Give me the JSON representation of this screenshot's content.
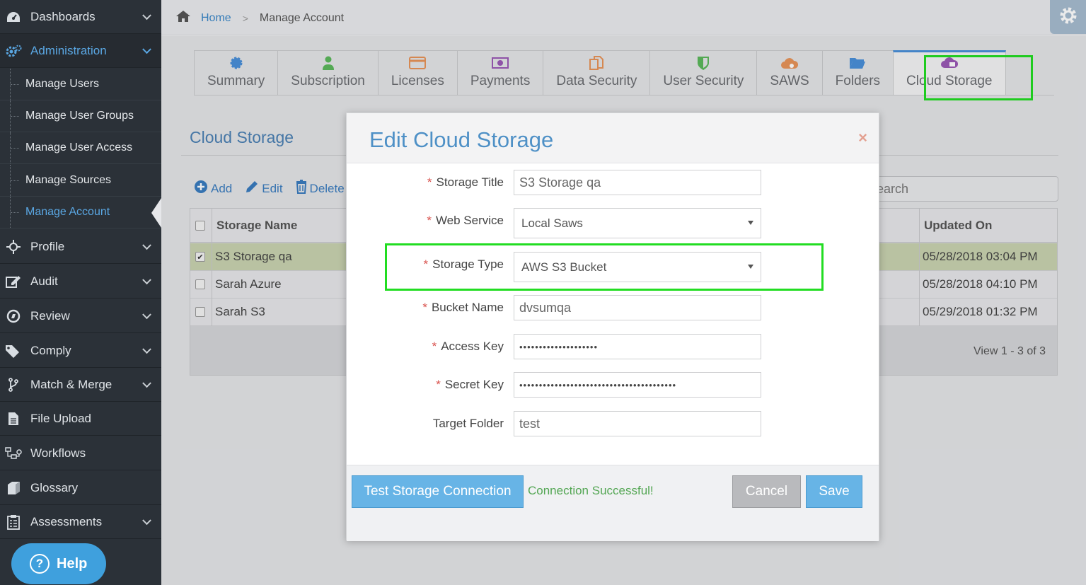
{
  "sidebar": {
    "items": [
      {
        "label": "Dashboards",
        "icon": "speedometer-icon"
      },
      {
        "label": "Administration",
        "icon": "gears-icon"
      },
      {
        "label": "Profile",
        "icon": "crosshair-icon"
      },
      {
        "label": "Audit",
        "icon": "edit-icon"
      },
      {
        "label": "Review",
        "icon": "compass-icon"
      },
      {
        "label": "Comply",
        "icon": "tags-icon"
      },
      {
        "label": "Match & Merge",
        "icon": "branch-icon"
      },
      {
        "label": "File Upload",
        "icon": "file-icon"
      },
      {
        "label": "Workflows",
        "icon": "workflow-icon"
      },
      {
        "label": "Glossary",
        "icon": "book-icon"
      },
      {
        "label": "Assessments",
        "icon": "clipboard-icon"
      }
    ],
    "sub_items": [
      "Manage Users",
      "Manage User Groups",
      "Manage User Access",
      "Manage Sources",
      "Manage Account"
    ],
    "help_label": "Help"
  },
  "breadcrumb": {
    "home": "Home",
    "current": "Manage Account"
  },
  "tabs": [
    {
      "label": "Summary",
      "icon": "gear-icon",
      "color": "#4a90d9"
    },
    {
      "label": "Subscription",
      "icon": "user-icon",
      "color": "#5cb85c"
    },
    {
      "label": "Licenses",
      "icon": "card-icon",
      "color": "#e8945a"
    },
    {
      "label": "Payments",
      "icon": "money-icon",
      "color": "#9b59b6"
    },
    {
      "label": "Data Security",
      "icon": "copy-icon",
      "color": "#e8945a"
    },
    {
      "label": "User Security",
      "icon": "shield-icon",
      "color": "#5cb85c"
    },
    {
      "label": "SAWS",
      "icon": "cloud-gear-icon",
      "color": "#e8945a"
    },
    {
      "label": "Folders",
      "icon": "folder-icon",
      "color": "#4a90d9"
    },
    {
      "label": "Cloud Storage",
      "icon": "cloud-icon",
      "color": "#9b59b6"
    }
  ],
  "section_title": "Cloud Storage",
  "toolbar": {
    "add": "Add",
    "edit": "Edit",
    "delete": "Delete"
  },
  "search_placeholder": "earch",
  "grid": {
    "columns": [
      "Storage Name",
      "Updated On"
    ],
    "rows": [
      {
        "name": "S3 Storage qa",
        "updated": "05/28/2018 03:04 PM",
        "checked": true
      },
      {
        "name": "Sarah Azure",
        "updated": "05/28/2018 04:10 PM",
        "checked": false
      },
      {
        "name": "Sarah S3",
        "updated": "05/29/2018 01:32 PM",
        "checked": false
      }
    ],
    "pager": "View 1 - 3 of 3"
  },
  "modal": {
    "title": "Edit Cloud Storage",
    "close": "×",
    "fields": {
      "storage_title": {
        "label": "Storage Title",
        "value": "S3 Storage qa"
      },
      "web_service": {
        "label": "Web Service",
        "value": "Local Saws"
      },
      "storage_type": {
        "label": "Storage Type",
        "value": "AWS S3 Bucket"
      },
      "bucket_name": {
        "label": "Bucket Name",
        "value": "dvsumqa"
      },
      "access_key": {
        "label": "Access Key",
        "value": "••••••••••••••••••••"
      },
      "secret_key": {
        "label": "Secret Key",
        "value": "••••••••••••••••••••••••••••••••••••••••"
      },
      "target_folder": {
        "label": "Target Folder",
        "value": "test"
      }
    },
    "required_mark": "*",
    "test_button": "Test Storage Connection",
    "connection_message": "Connection Successful!",
    "cancel_button": "Cancel",
    "save_button": "Save"
  },
  "colors": {
    "highlight": "#22dd22",
    "accent": "#4e90c6",
    "success": "#53a653"
  }
}
